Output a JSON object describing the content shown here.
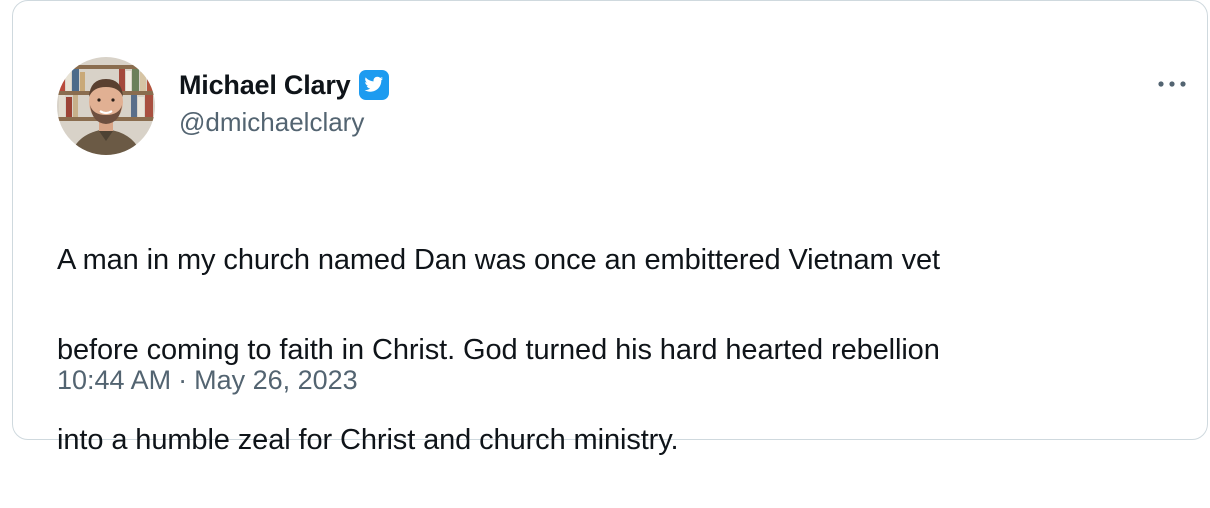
{
  "author": {
    "display_name": "Michael Clary",
    "handle": "@dmichaelclary",
    "verified": true
  },
  "icons": {
    "verified": "verified-badge-icon",
    "more": "more-options-icon"
  },
  "colors": {
    "verified_blue": "#1d9bf0",
    "text_primary": "#0f1419",
    "text_secondary": "#536471",
    "border": "#cfd9de"
  },
  "tweet": {
    "text_lines": [
      "A man in my church named Dan was once an embittered Vietnam vet",
      "before coming to faith in Christ. God turned his hard hearted rebellion",
      "into a humble zeal for Christ and church ministry."
    ],
    "time": "10:44 AM",
    "separator": "·",
    "date": "May 26, 2023"
  }
}
